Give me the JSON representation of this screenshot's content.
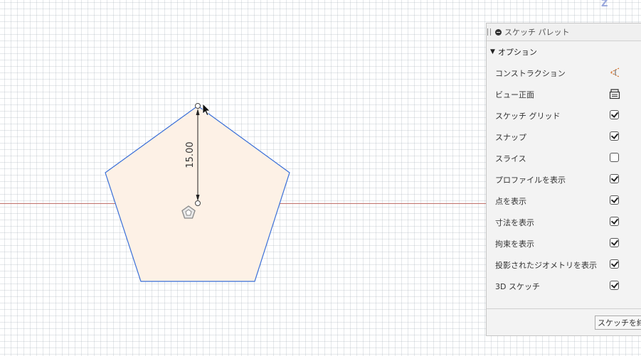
{
  "viewport": {
    "axis_label": "Z"
  },
  "dimension": {
    "value": "15.00"
  },
  "palette": {
    "title": "スケッチ パレット",
    "section_title": "オプション",
    "options": [
      {
        "label": "コンストラクション",
        "type": "icon",
        "icon": "construction-icon"
      },
      {
        "label": "ビュー正面",
        "type": "icon",
        "icon": "look-at-icon"
      },
      {
        "label": "スケッチ グリッド",
        "type": "checkbox",
        "checked": true
      },
      {
        "label": "スナップ",
        "type": "checkbox",
        "checked": true
      },
      {
        "label": "スライス",
        "type": "checkbox",
        "checked": false
      },
      {
        "label": "プロファイルを表示",
        "type": "checkbox",
        "checked": true
      },
      {
        "label": "点を表示",
        "type": "checkbox",
        "checked": true
      },
      {
        "label": "寸法を表示",
        "type": "checkbox",
        "checked": true
      },
      {
        "label": "拘束を表示",
        "type": "checkbox",
        "checked": true
      },
      {
        "label": "投影されたジオメトリを表示",
        "type": "checkbox",
        "checked": true
      },
      {
        "label": "3D スケッチ",
        "type": "checkbox",
        "checked": true
      }
    ],
    "finish_button": "スケッチを終了"
  },
  "colors": {
    "profile_fill": "#fdf1e6",
    "sketch_line": "#3a6fd8",
    "axis_line": "#c0706a",
    "accent_construction": "#d2691e"
  }
}
